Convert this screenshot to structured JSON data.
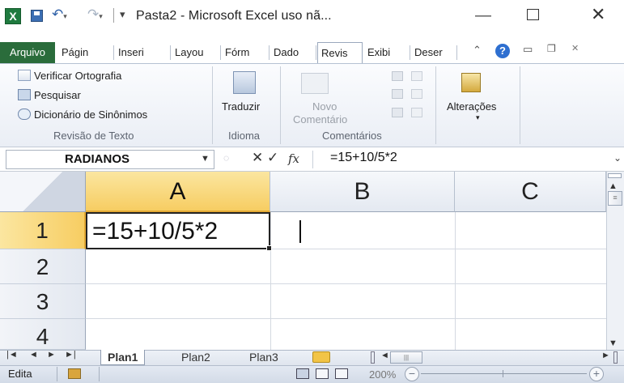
{
  "window": {
    "title": "Pasta2 - Microsoft Excel uso nã...",
    "app_icon_letter": "X",
    "min_glyph": "—",
    "close_glyph": "✕"
  },
  "ribbon_tabs": {
    "file": "Arquivo",
    "items": [
      "Págin",
      "Inseri",
      "Layou",
      "Fórm",
      "Dado",
      "Revis",
      "Exibi",
      "Deser"
    ],
    "active_index": 5
  },
  "ribbon": {
    "spell": "Verificar Ortografia",
    "research": "Pesquisar",
    "thesaurus": "Dicionário de Sinônimos",
    "group_review": "Revisão de Texto",
    "translate": "Traduzir",
    "group_language": "Idioma",
    "new_comment_1": "Novo",
    "new_comment_2": "Comentário",
    "group_comments": "Comentários",
    "changes": "Alterações"
  },
  "formula_bar": {
    "name_box": "RADIANOS",
    "fx": "fx",
    "content": "=15+10/5*2"
  },
  "grid": {
    "columns": [
      "A",
      "B",
      "C"
    ],
    "rows": [
      "1",
      "2",
      "3",
      "4"
    ],
    "active_cell_value": "=15+10/5*2",
    "active_column": "A",
    "active_row": "1"
  },
  "sheets": {
    "tabs": [
      "Plan1",
      "Plan2",
      "Plan3"
    ],
    "active": "Plan1"
  },
  "status": {
    "mode": "Edita",
    "zoom": "200%"
  },
  "colors": {
    "file_tab": "#2a6c3b",
    "selected_header": "#f7cd62",
    "help": "#2e6fd0"
  }
}
